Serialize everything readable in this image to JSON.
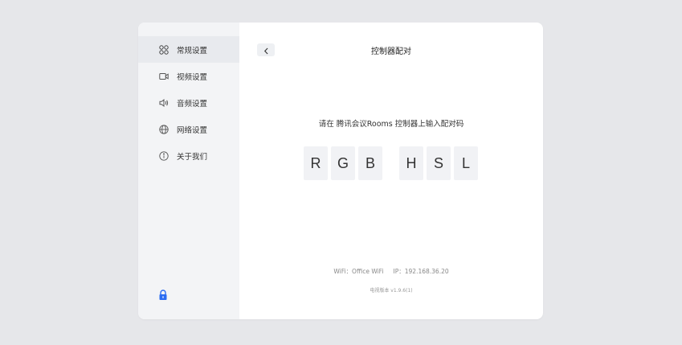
{
  "sidebar": {
    "items": [
      {
        "label": "常规设置",
        "icon": "general-settings-icon",
        "active": true
      },
      {
        "label": "视频设置",
        "icon": "video-icon",
        "active": false
      },
      {
        "label": "音频设置",
        "icon": "audio-icon",
        "active": false
      },
      {
        "label": "网络设置",
        "icon": "globe-icon",
        "active": false
      },
      {
        "label": "关于我们",
        "icon": "info-icon",
        "active": false
      }
    ],
    "lock_icon": "lock-icon"
  },
  "main": {
    "back_icon": "chevron-left-icon",
    "title": "控制器配对",
    "instruction": "请在 腾讯会议Rooms 控制器上输入配对码",
    "codes": [
      "R",
      "G",
      "B",
      "H",
      "S",
      "L"
    ],
    "wifi": "WiFi：Office WiFi",
    "ip": "IP：192.168.36.20",
    "version": "电视版本 v1.9.6(1)"
  },
  "colors": {
    "background": "#e6e7ea",
    "sidebar": "#f3f4f6",
    "active_item": "#e8eaee",
    "lock": "#2a6bf2",
    "code_box": "#f1f2f5"
  }
}
